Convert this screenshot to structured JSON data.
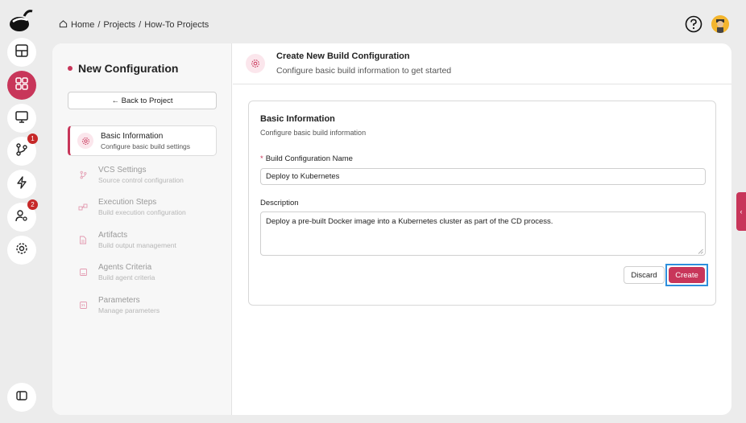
{
  "breadcrumb": {
    "home": "Home",
    "sep1": "/",
    "projects": "Projects",
    "sep2": "/",
    "current": "How-To Projects"
  },
  "rail": {
    "items": [
      {
        "icon": "dashboard-icon"
      },
      {
        "icon": "apps-grid-icon",
        "active": true
      },
      {
        "icon": "monitor-icon"
      },
      {
        "icon": "git-branch-icon",
        "badge": "1"
      },
      {
        "icon": "lightning-icon"
      },
      {
        "icon": "user-settings-icon",
        "badge": "2"
      },
      {
        "icon": "gear-icon"
      }
    ],
    "collapse_icon": "sidebar-toggle-icon"
  },
  "colors": {
    "accent": "#c8365a",
    "focus": "#2e8fdc",
    "avatar": "#f3b52e"
  },
  "left_pane": {
    "title": "New Configuration",
    "back_label": "← Back to Project",
    "steps": [
      {
        "title": "Basic Information",
        "subtitle": "Configure basic build settings",
        "icon": "gear-icon",
        "active": true
      },
      {
        "title": "VCS Settings",
        "subtitle": "Source control configuration",
        "icon": "git-branch-icon"
      },
      {
        "title": "Execution Steps",
        "subtitle": "Build execution configuration",
        "icon": "steps-icon"
      },
      {
        "title": "Artifacts",
        "subtitle": "Build output management",
        "icon": "file-icon"
      },
      {
        "title": "Agents Criteria",
        "subtitle": "Build agent criteria",
        "icon": "agent-icon"
      },
      {
        "title": "Parameters",
        "subtitle": "Manage parameters",
        "icon": "parameters-icon"
      }
    ]
  },
  "right_pane": {
    "header_title": "Create New Build Configuration",
    "header_subtitle": "Configure basic build information to get started",
    "section_title": "Basic Information",
    "section_subtitle": "Configure basic build information",
    "name_required": "*",
    "name_label": "Build Configuration Name",
    "name_value": "Deploy to Kubernetes",
    "description_label": "Description",
    "description_value": "Deploy a pre-built Docker image into a Kubernetes cluster as part of the CD process.",
    "discard_label": "Discard",
    "create_label": "Create"
  },
  "side_tab_glyph": "‹"
}
